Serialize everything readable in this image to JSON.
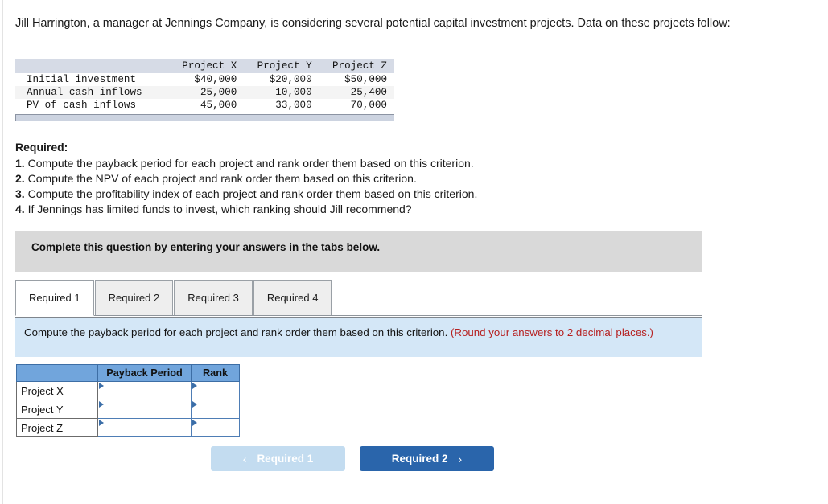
{
  "intro": {
    "paragraph": "Jill Harrington, a manager at Jennings Company, is considering several potential capital investment projects. Data on these projects follow:"
  },
  "data_table": {
    "corner_header": "",
    "columns": [
      "Project X",
      "Project Y",
      "Project Z"
    ],
    "rows": [
      {
        "label": "Initial investment",
        "values": [
          "$40,000",
          "$20,000",
          "$50,000"
        ]
      },
      {
        "label": "Annual cash inflows",
        "values": [
          "25,000",
          "10,000",
          "25,400"
        ]
      },
      {
        "label": "PV of cash inflows",
        "values": [
          "45,000",
          "33,000",
          "70,000"
        ]
      }
    ]
  },
  "required": {
    "title": "Required:",
    "items": [
      {
        "num": "1.",
        "text": "Compute the payback period for each project and rank order them based on this criterion."
      },
      {
        "num": "2.",
        "text": "Compute the NPV of each project and rank order them based on this criterion."
      },
      {
        "num": "3.",
        "text": "Compute the profitability index of each project and rank order them based on this criterion."
      },
      {
        "num": "4.",
        "text": "If Jennings has limited funds to invest, which ranking should Jill recommend?"
      }
    ]
  },
  "instruction_bar": {
    "text": "Complete this question by entering your answers in the tabs below."
  },
  "tabs": [
    {
      "label": "Required 1",
      "active": true
    },
    {
      "label": "Required 2",
      "active": false
    },
    {
      "label": "Required 3",
      "active": false
    },
    {
      "label": "Required 4",
      "active": false
    }
  ],
  "banner": {
    "text": "Compute the payback period for each project and rank order them based on this criterion.",
    "rounding_note": "(Round your answers to 2 decimal places.)",
    "rounding_color": "#b62020"
  },
  "answer_table": {
    "corner_header": "",
    "headers": [
      "Payback Period",
      "Rank"
    ],
    "rows": [
      {
        "label": "Project X",
        "payback_period": "",
        "rank": ""
      },
      {
        "label": "Project Y",
        "payback_period": "",
        "rank": ""
      },
      {
        "label": "Project Z",
        "payback_period": "",
        "rank": ""
      }
    ]
  },
  "navigation": {
    "prev_label": "Required 1",
    "prev_icon": "chevron-left-icon",
    "prev_glyph": "‹",
    "prev_enabled": false,
    "next_label": "Required 2",
    "next_icon": "chevron-right-icon",
    "next_glyph": "›",
    "next_enabled": true,
    "prev_color": "#c3dcf0",
    "next_color": "#2a65ab"
  }
}
